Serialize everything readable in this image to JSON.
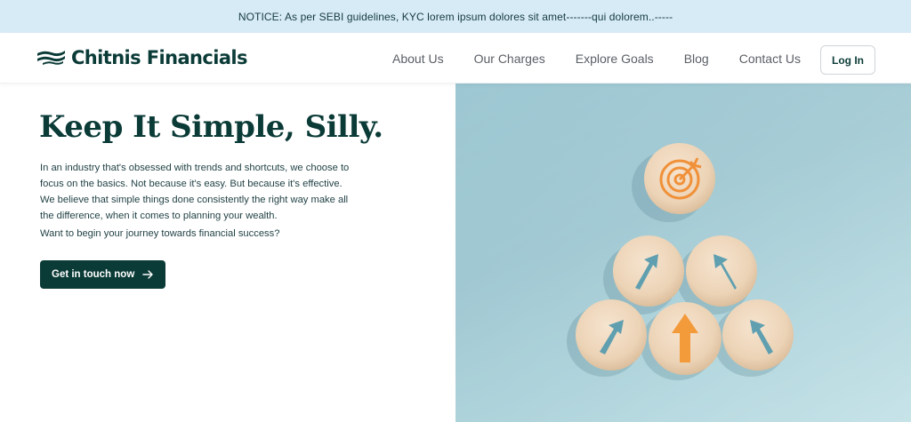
{
  "notice": {
    "text": "NOTICE: As per SEBI guidelines, KYC lorem ipsum dolores sit amet-------qui dolorem..-----"
  },
  "header": {
    "brand": "Chitnis Financials",
    "nav": [
      {
        "label": "About Us"
      },
      {
        "label": "Our Charges"
      },
      {
        "label": "Explore Goals"
      },
      {
        "label": "Blog"
      },
      {
        "label": "Contact Us"
      }
    ],
    "login_label": "Log In"
  },
  "hero": {
    "headline": "Keep It Simple, Silly.",
    "body": "In an industry that's obsessed with trends and shortcuts, we choose to focus on the basics. Not because it's easy. But because it's effective. We believe that simple things done consistently the right way make all the difference, when it comes to planning your wealth.",
    "question": "Want to begin your journey towards financial success?",
    "cta_label": "Get in touch now"
  },
  "colors": {
    "brand": "#0b3b37",
    "notice_bg": "#d7ebf6",
    "hero_image_bg": "#a6cdd7",
    "accent_orange": "#f39a3b",
    "arrow_teal": "#5f9fb0"
  },
  "icons": {
    "brand_mark": "stacked-wave-logo-icon",
    "cta": "arrow-right-icon",
    "image": "target-and-arrows-wooden-discs"
  }
}
